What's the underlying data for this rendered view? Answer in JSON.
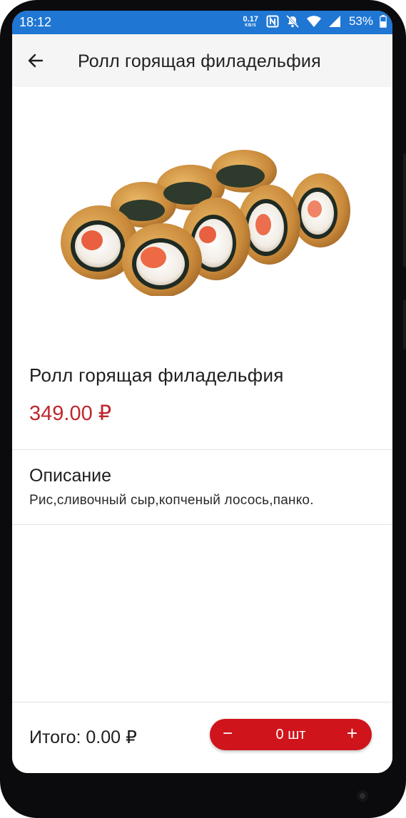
{
  "status_bar": {
    "time": "18:12",
    "net_speed_value": "0.17",
    "net_speed_unit": "KB/S",
    "battery_percent": "53%",
    "icons": [
      "nfc-icon",
      "mute-icon",
      "wifi-icon",
      "signal-icon",
      "battery-icon"
    ]
  },
  "app_bar": {
    "title": "Ролл горящая филадельфия",
    "back_icon": "arrow-left-icon"
  },
  "product": {
    "image_alt": "sushi rolls",
    "name": "Ролл горящая филадельфия",
    "price": "349.00 ₽"
  },
  "description": {
    "title": "Описание",
    "text": "Рис,сливочный сыр,копченый лосось,панко."
  },
  "bottom_bar": {
    "total": "Итого: 0.00 ₽",
    "minus_label": "−",
    "quantity": "0 шт",
    "plus_label": "+"
  },
  "colors": {
    "status_bar": "#1f76d3",
    "accent_red": "#d0141b",
    "price_red": "#c0272d",
    "app_bar_bg": "#f5f5f5"
  }
}
